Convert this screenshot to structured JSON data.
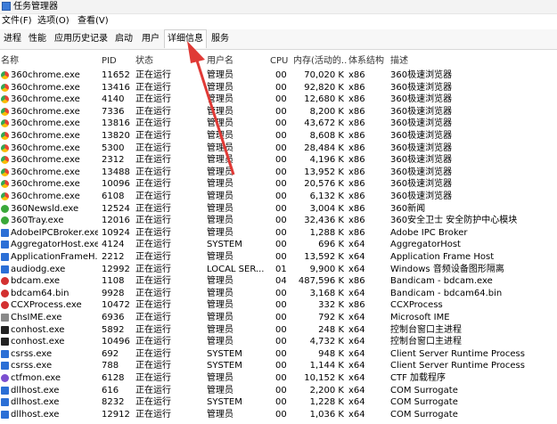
{
  "window": {
    "title": "任务管理器"
  },
  "menu": [
    "文件(F)",
    "选项(O)",
    "查看(V)"
  ],
  "tabs": [
    "进程",
    "性能",
    "应用历史记录",
    "启动",
    "用户",
    "详细信息",
    "服务"
  ],
  "active_tab": "详细信息",
  "columns": [
    "名称",
    "PID",
    "状态",
    "用户名",
    "CPU",
    "内存(活动的...",
    "体系结构",
    "描述"
  ],
  "colors": {
    "chrome": "#e9a320",
    "tray": "#3aa83a",
    "blue": "#2b6fd6",
    "red": "#d33030",
    "black": "#222222",
    "purple": "#7b4fd0",
    "gray": "#8a8a8a",
    "arrow": "#e03a36"
  },
  "rows": [
    {
      "name": "360chrome.exe",
      "pid": "11652",
      "status": "正在运行",
      "user": "管理员",
      "cpu": "00",
      "mem": "70,020 K",
      "arch": "x86",
      "desc": "360极速浏览器",
      "icon": "chrome-icon",
      "color": "chrome"
    },
    {
      "name": "360chrome.exe",
      "pid": "13416",
      "status": "正在运行",
      "user": "管理员",
      "cpu": "00",
      "mem": "92,820 K",
      "arch": "x86",
      "desc": "360极速浏览器",
      "icon": "chrome-icon",
      "color": "chrome"
    },
    {
      "name": "360chrome.exe",
      "pid": "4140",
      "status": "正在运行",
      "user": "管理员",
      "cpu": "00",
      "mem": "12,680 K",
      "arch": "x86",
      "desc": "360极速浏览器",
      "icon": "chrome-icon",
      "color": "chrome"
    },
    {
      "name": "360chrome.exe",
      "pid": "7336",
      "status": "正在运行",
      "user": "管理员",
      "cpu": "00",
      "mem": "8,200 K",
      "arch": "x86",
      "desc": "360极速浏览器",
      "icon": "chrome-icon",
      "color": "chrome"
    },
    {
      "name": "360chrome.exe",
      "pid": "13816",
      "status": "正在运行",
      "user": "管理员",
      "cpu": "00",
      "mem": "43,672 K",
      "arch": "x86",
      "desc": "360极速浏览器",
      "icon": "chrome-icon",
      "color": "chrome"
    },
    {
      "name": "360chrome.exe",
      "pid": "13820",
      "status": "正在运行",
      "user": "管理员",
      "cpu": "00",
      "mem": "8,608 K",
      "arch": "x86",
      "desc": "360极速浏览器",
      "icon": "chrome-icon",
      "color": "chrome"
    },
    {
      "name": "360chrome.exe",
      "pid": "5300",
      "status": "正在运行",
      "user": "管理员",
      "cpu": "00",
      "mem": "28,484 K",
      "arch": "x86",
      "desc": "360极速浏览器",
      "icon": "chrome-icon",
      "color": "chrome"
    },
    {
      "name": "360chrome.exe",
      "pid": "2312",
      "status": "正在运行",
      "user": "管理员",
      "cpu": "00",
      "mem": "4,196 K",
      "arch": "x86",
      "desc": "360极速浏览器",
      "icon": "chrome-icon",
      "color": "chrome"
    },
    {
      "name": "360chrome.exe",
      "pid": "13488",
      "status": "正在运行",
      "user": "管理员",
      "cpu": "00",
      "mem": "13,952 K",
      "arch": "x86",
      "desc": "360极速浏览器",
      "icon": "chrome-icon",
      "color": "chrome"
    },
    {
      "name": "360chrome.exe",
      "pid": "10096",
      "status": "正在运行",
      "user": "管理员",
      "cpu": "00",
      "mem": "20,576 K",
      "arch": "x86",
      "desc": "360极速浏览器",
      "icon": "chrome-icon",
      "color": "chrome"
    },
    {
      "name": "360chrome.exe",
      "pid": "6108",
      "status": "正在运行",
      "user": "管理员",
      "cpu": "00",
      "mem": "6,132 K",
      "arch": "x86",
      "desc": "360极速浏览器",
      "icon": "chrome-icon",
      "color": "chrome"
    },
    {
      "name": "360Newsld.exe",
      "pid": "12524",
      "status": "正在运行",
      "user": "管理员",
      "cpu": "00",
      "mem": "3,004 K",
      "arch": "x86",
      "desc": "360新闻",
      "icon": "news-icon",
      "color": "tray"
    },
    {
      "name": "360Tray.exe",
      "pid": "12016",
      "status": "正在运行",
      "user": "管理员",
      "cpu": "00",
      "mem": "32,436 K",
      "arch": "x86",
      "desc": "360安全卫士 安全防护中心模块",
      "icon": "shield-icon",
      "color": "tray"
    },
    {
      "name": "AdobeIPCBroker.exe",
      "pid": "10924",
      "status": "正在运行",
      "user": "管理员",
      "cpu": "00",
      "mem": "1,288 K",
      "arch": "x86",
      "desc": "Adobe IPC Broker",
      "icon": "app-icon",
      "color": "blue"
    },
    {
      "name": "AggregatorHost.exe",
      "pid": "4124",
      "status": "正在运行",
      "user": "SYSTEM",
      "cpu": "00",
      "mem": "696 K",
      "arch": "x64",
      "desc": "AggregatorHost",
      "icon": "app-icon",
      "color": "blue"
    },
    {
      "name": "ApplicationFrameH...",
      "pid": "2212",
      "status": "正在运行",
      "user": "管理员",
      "cpu": "00",
      "mem": "13,592 K",
      "arch": "x64",
      "desc": "Application Frame Host",
      "icon": "app-icon",
      "color": "blue"
    },
    {
      "name": "audiodg.exe",
      "pid": "12992",
      "status": "正在运行",
      "user": "LOCAL SER...",
      "cpu": "01",
      "mem": "9,900 K",
      "arch": "x64",
      "desc": "Windows 音频设备图形隔离",
      "icon": "app-icon",
      "color": "blue"
    },
    {
      "name": "bdcam.exe",
      "pid": "1108",
      "status": "正在运行",
      "user": "管理员",
      "cpu": "04",
      "mem": "487,596 K",
      "arch": "x86",
      "desc": "Bandicam - bdcam.exe",
      "icon": "record-icon",
      "color": "red"
    },
    {
      "name": "bdcam64.bin",
      "pid": "9928",
      "status": "正在运行",
      "user": "管理员",
      "cpu": "00",
      "mem": "3,168 K",
      "arch": "x64",
      "desc": "Bandicam - bdcam64.bin",
      "icon": "record-icon",
      "color": "red"
    },
    {
      "name": "CCXProcess.exe",
      "pid": "10472",
      "status": "正在运行",
      "user": "管理员",
      "cpu": "00",
      "mem": "332 K",
      "arch": "x86",
      "desc": "CCXProcess",
      "icon": "cc-icon",
      "color": "red"
    },
    {
      "name": "ChsIME.exe",
      "pid": "6936",
      "status": "正在运行",
      "user": "管理员",
      "cpu": "00",
      "mem": "792 K",
      "arch": "x64",
      "desc": "Microsoft IME",
      "icon": "ime-icon",
      "color": "gray"
    },
    {
      "name": "conhost.exe",
      "pid": "5892",
      "status": "正在运行",
      "user": "管理员",
      "cpu": "00",
      "mem": "248 K",
      "arch": "x64",
      "desc": "控制台窗口主进程",
      "icon": "console-icon",
      "color": "black"
    },
    {
      "name": "conhost.exe",
      "pid": "10496",
      "status": "正在运行",
      "user": "管理员",
      "cpu": "00",
      "mem": "4,732 K",
      "arch": "x64",
      "desc": "控制台窗口主进程",
      "icon": "console-icon",
      "color": "black"
    },
    {
      "name": "csrss.exe",
      "pid": "692",
      "status": "正在运行",
      "user": "SYSTEM",
      "cpu": "00",
      "mem": "948 K",
      "arch": "x64",
      "desc": "Client Server Runtime Process",
      "icon": "app-icon",
      "color": "blue"
    },
    {
      "name": "csrss.exe",
      "pid": "788",
      "status": "正在运行",
      "user": "SYSTEM",
      "cpu": "00",
      "mem": "1,144 K",
      "arch": "x64",
      "desc": "Client Server Runtime Process",
      "icon": "app-icon",
      "color": "blue"
    },
    {
      "name": "ctfmon.exe",
      "pid": "6128",
      "status": "正在运行",
      "user": "管理员",
      "cpu": "00",
      "mem": "10,152 K",
      "arch": "x64",
      "desc": "CTF 加载程序",
      "icon": "pen-icon",
      "color": "purple"
    },
    {
      "name": "dllhost.exe",
      "pid": "616",
      "status": "正在运行",
      "user": "管理员",
      "cpu": "00",
      "mem": "2,200 K",
      "arch": "x64",
      "desc": "COM Surrogate",
      "icon": "app-icon",
      "color": "blue"
    },
    {
      "name": "dllhost.exe",
      "pid": "8232",
      "status": "正在运行",
      "user": "SYSTEM",
      "cpu": "00",
      "mem": "1,228 K",
      "arch": "x64",
      "desc": "COM Surrogate",
      "icon": "app-icon",
      "color": "blue"
    },
    {
      "name": "dllhost.exe",
      "pid": "12912",
      "status": "正在运行",
      "user": "管理员",
      "cpu": "00",
      "mem": "1,036 K",
      "arch": "x64",
      "desc": "COM Surrogate",
      "icon": "app-icon",
      "color": "blue"
    }
  ]
}
